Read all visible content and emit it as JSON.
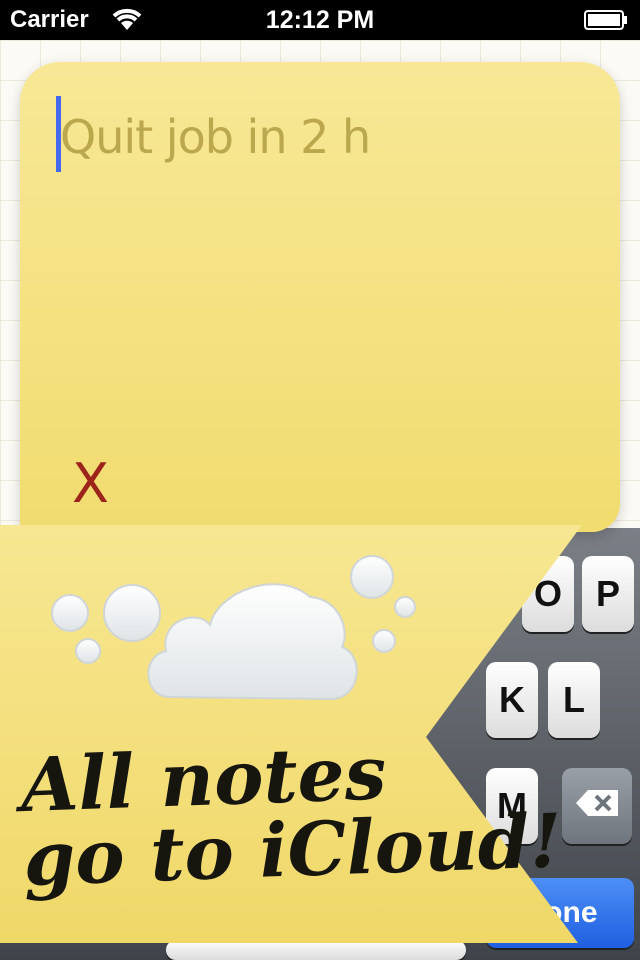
{
  "status_bar": {
    "carrier": "Carrier",
    "time": "12:12 PM",
    "wifi_icon": "wifi-icon",
    "battery_icon": "battery-icon"
  },
  "note": {
    "text": "Quit job in 2 h",
    "close_label": "X",
    "color": "#f5e27f"
  },
  "keyboard": {
    "keys": [
      "O",
      "P",
      "K",
      "L",
      "M"
    ],
    "done_label": "Done",
    "backspace_icon": "backspace-icon"
  },
  "promo": {
    "line1": "All notes",
    "line2": "go to iCloud!",
    "cloud_icon": "cloud-icon"
  },
  "colors": {
    "note_yellow": "#f5e27f",
    "caret_blue": "#4469ee",
    "close_red": "#9c241a",
    "done_blue": "#2a6bea"
  }
}
